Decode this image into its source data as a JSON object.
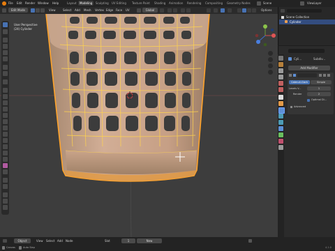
{
  "menu": {
    "items": [
      "File",
      "Edit",
      "Render",
      "Window",
      "Help"
    ],
    "workspaces": [
      "Layout",
      "Modeling",
      "Sculpting",
      "UV Editing",
      "Texture Paint",
      "Shading",
      "Animation",
      "Rendering",
      "Compositing",
      "Geometry Nodes"
    ],
    "active_workspace": "Modeling",
    "scene_label": "Scene",
    "view_layer_label": "ViewLayer"
  },
  "viewport_header": {
    "mode": "Edit Mode",
    "menus": [
      "View",
      "Select",
      "Add",
      "Mesh",
      "Vertex",
      "Edge",
      "Face",
      "UV"
    ],
    "transform_orientation": "Global",
    "options_label": "Options"
  },
  "viewport": {
    "view_name": "User Perspective",
    "object_name": "(24) Cylinder"
  },
  "outliner": {
    "collection": "Scene Collection",
    "object": "Cylinder"
  },
  "properties": {
    "search_placeholder": "",
    "modifier_header": "Cyli...",
    "modifier_header2": "Subdiv...",
    "add_modifier": "Add Modifier",
    "catmull": "Catmull-Clark",
    "simple": "Simple",
    "levels_viewport_label": "Levels V...",
    "levels_viewport_value": "1",
    "render_label": "Render",
    "render_value": "2",
    "optimal_display": "Optimal Di...",
    "advanced": "Advanced"
  },
  "statusbar": {
    "object_menu": "Object",
    "menus": [
      "View",
      "Select",
      "Add",
      "Node"
    ],
    "slot_label": "Slot",
    "slot_value": "1",
    "new_button": "New",
    "hint_left": "Canvas",
    "hint_right": "Auto Slap",
    "version": "4.1.0"
  },
  "colors": {
    "accent": "#4772b3",
    "selection": "#ffa32a",
    "edge": "#ffd34d",
    "mesh": "#c7a48d",
    "background": "#3d3d3d"
  }
}
